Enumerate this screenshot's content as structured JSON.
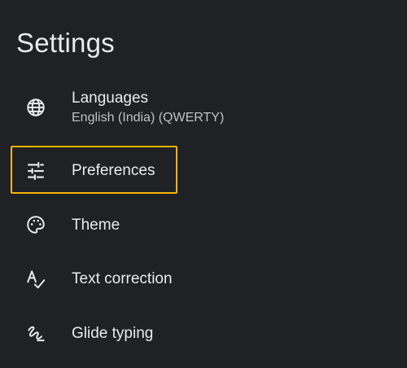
{
  "header": {
    "title": "Settings"
  },
  "settings": {
    "items": [
      {
        "label": "Languages",
        "subtitle": "English (India) (QWERTY)",
        "icon": "globe-icon"
      },
      {
        "label": "Preferences",
        "icon": "tune-sliders-icon",
        "highlighted": true
      },
      {
        "label": "Theme",
        "icon": "palette-icon"
      },
      {
        "label": "Text correction",
        "icon": "spellcheck-icon"
      },
      {
        "label": "Glide typing",
        "icon": "gesture-icon"
      }
    ]
  },
  "colors": {
    "background": "#202124",
    "text": "#e8eaed",
    "subtext": "#bdc1c6",
    "highlight": "#f4b400"
  }
}
